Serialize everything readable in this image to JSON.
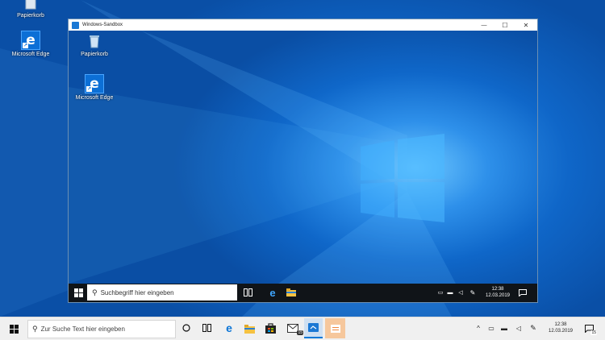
{
  "host": {
    "top_icon_label": "Papierkorb",
    "edge_label": "Microsoft Edge",
    "search_placeholder": "Zur Suche Text hier eingeben",
    "clock_time": "12:38",
    "clock_date": "12.03.2019",
    "notification_badge": "15"
  },
  "sandbox": {
    "window_title": "Windows-Sandbox",
    "minimize_glyph": "—",
    "maximize_glyph": "☐",
    "close_glyph": "✕",
    "recycle_label": "Papierkorb",
    "edge_label": "Microsoft Edge",
    "search_placeholder": "Suchbegriff hier eingeben",
    "clock_time": "12:38",
    "clock_date": "12.03.2019"
  },
  "icons": {
    "start": "windows-start-icon",
    "search": "search-icon",
    "cortana": "cortana-circle-icon",
    "task_view": "task-view-icon",
    "edge": "edge-icon",
    "explorer": "file-explorer-icon",
    "store": "store-icon",
    "mail": "mail-icon",
    "sandbox_app": "sandbox-icon",
    "notes": "notes-icon"
  },
  "colors": {
    "accent": "#0078d7",
    "sandbox_taskbar": "#101418",
    "host_taskbar": "#f0f0f0"
  }
}
